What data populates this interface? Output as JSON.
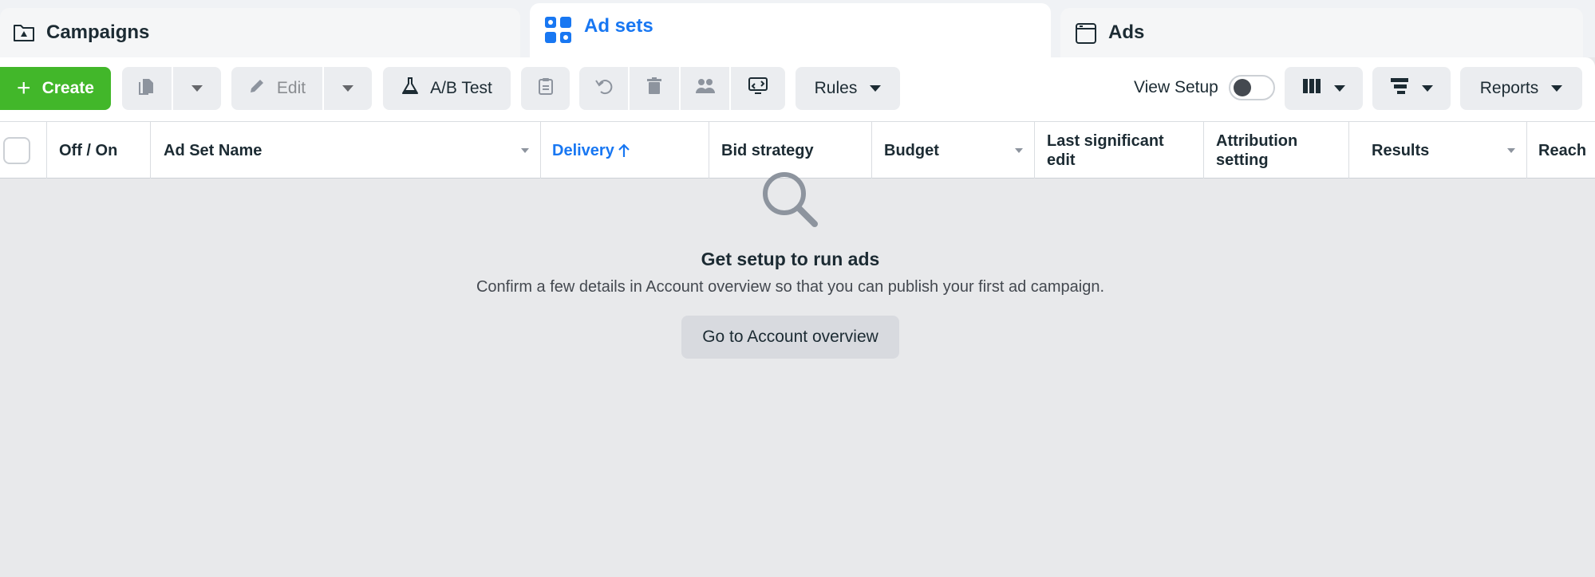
{
  "tabs": {
    "campaigns": "Campaigns",
    "adsets": "Ad sets",
    "ads": "Ads"
  },
  "toolbar": {
    "create": "Create",
    "edit": "Edit",
    "ab_test": "A/B Test",
    "rules": "Rules",
    "view_setup": "View Setup",
    "view_setup_enabled": false,
    "reports": "Reports"
  },
  "table": {
    "columns": [
      "Off / On",
      "Ad Set Name",
      "Delivery",
      "Bid strategy",
      "Budget",
      "Last significant edit",
      "Attribution setting",
      "Results",
      "Reach"
    ],
    "sorted_column": "Delivery",
    "sort_direction": "ascending"
  },
  "empty_state": {
    "title": "Get setup to run ads",
    "description": "Confirm a few details in Account overview so that you can publish your first ad campaign.",
    "button": "Go to Account overview"
  },
  "colors": {
    "accent_blue": "#1877f2",
    "create_green": "#42b72a"
  }
}
